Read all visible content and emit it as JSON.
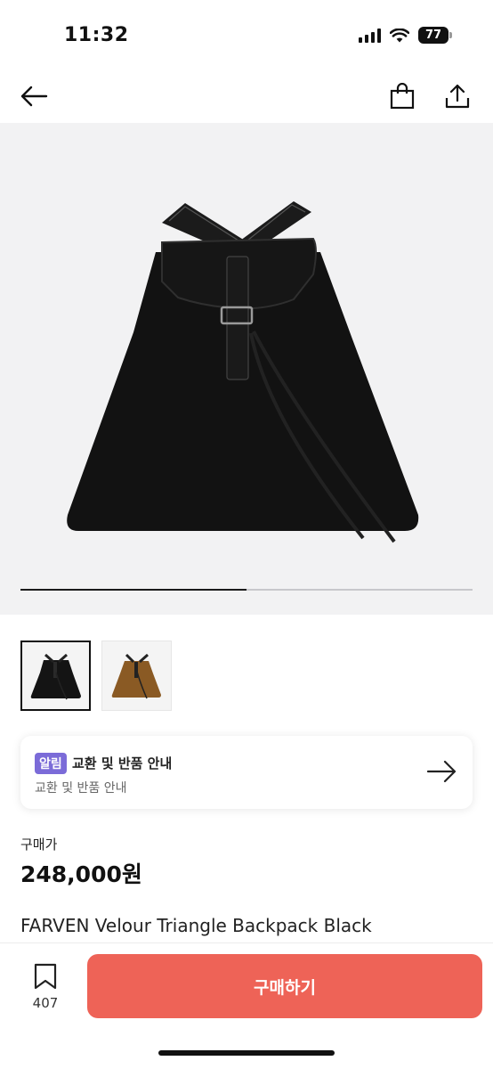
{
  "status_bar": {
    "time": "11:32",
    "battery": "77"
  },
  "header": {
    "back_icon": "arrow-left-icon",
    "cart_icon": "shopping-bag-icon",
    "share_icon": "share-icon"
  },
  "gallery": {
    "progress": 0.5,
    "image_count": 2,
    "active_index": 0
  },
  "thumbnails": [
    {
      "name": "black",
      "color": "#1a1a1a"
    },
    {
      "name": "brown",
      "color": "#8a5a24"
    }
  ],
  "notice": {
    "badge": "알림",
    "title": "교환 및 반품 안내",
    "subtitle": "교환 및 반품 안내"
  },
  "price": {
    "label": "구매가",
    "value": "248,000원"
  },
  "product": {
    "name": "FARVEN Velour Triangle Backpack Black"
  },
  "bottom": {
    "bookmark_count": "407",
    "buy_label": "구매하기"
  },
  "colors": {
    "accent": "#ee6357",
    "badge": "#7b6bd8"
  }
}
